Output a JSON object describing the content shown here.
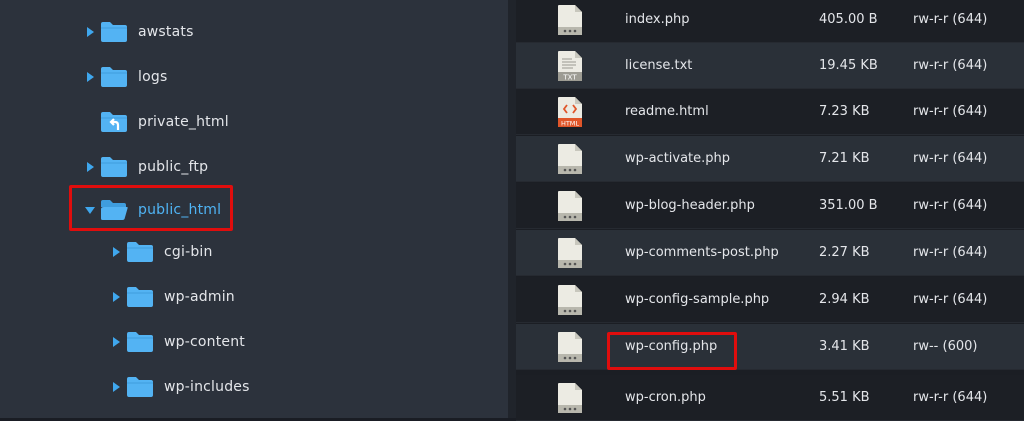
{
  "tree": {
    "items": [
      {
        "label": "awstats",
        "expanded": false,
        "icon": "folder-icon"
      },
      {
        "label": "logs",
        "expanded": false,
        "icon": "folder-icon"
      },
      {
        "label": "private_html",
        "expanded": null,
        "icon": "folder-link-icon"
      },
      {
        "label": "public_ftp",
        "expanded": false,
        "icon": "folder-icon"
      },
      {
        "label": "public_html",
        "expanded": true,
        "icon": "folder-open-icon"
      },
      {
        "label": "cgi-bin",
        "expanded": false,
        "icon": "folder-icon"
      },
      {
        "label": "wp-admin",
        "expanded": false,
        "icon": "folder-icon"
      },
      {
        "label": "wp-content",
        "expanded": false,
        "icon": "folder-icon"
      },
      {
        "label": "wp-includes",
        "expanded": false,
        "icon": "folder-icon"
      }
    ]
  },
  "files": [
    {
      "name": "index.php",
      "size": "405.00 B",
      "perms": "rw-r-r (644)",
      "icon": "php-file-icon"
    },
    {
      "name": "license.txt",
      "size": "19.45 KB",
      "perms": "rw-r-r (644)",
      "icon": "txt-file-icon"
    },
    {
      "name": "readme.html",
      "size": "7.23 KB",
      "perms": "rw-r-r (644)",
      "icon": "html-file-icon"
    },
    {
      "name": "wp-activate.php",
      "size": "7.21 KB",
      "perms": "rw-r-r (644)",
      "icon": "php-file-icon"
    },
    {
      "name": "wp-blog-header.php",
      "size": "351.00 B",
      "perms": "rw-r-r (644)",
      "icon": "php-file-icon"
    },
    {
      "name": "wp-comments-post.php",
      "size": "2.27 KB",
      "perms": "rw-r-r (644)",
      "icon": "php-file-icon"
    },
    {
      "name": "wp-config-sample.php",
      "size": "2.94 KB",
      "perms": "rw-r-r (644)",
      "icon": "php-file-icon"
    },
    {
      "name": "wp-config.php",
      "size": "3.41 KB",
      "perms": "rw-- (600)",
      "icon": "php-file-icon"
    },
    {
      "name": "wp-cron.php",
      "size": "5.51 KB",
      "perms": "rw-r-r (644)",
      "icon": "php-file-icon"
    }
  ],
  "colors": {
    "folder": "#53b3f3",
    "selected_text": "#4fb4f5",
    "highlight_box": "#e00d0d",
    "html_badge": "#e0562a"
  }
}
